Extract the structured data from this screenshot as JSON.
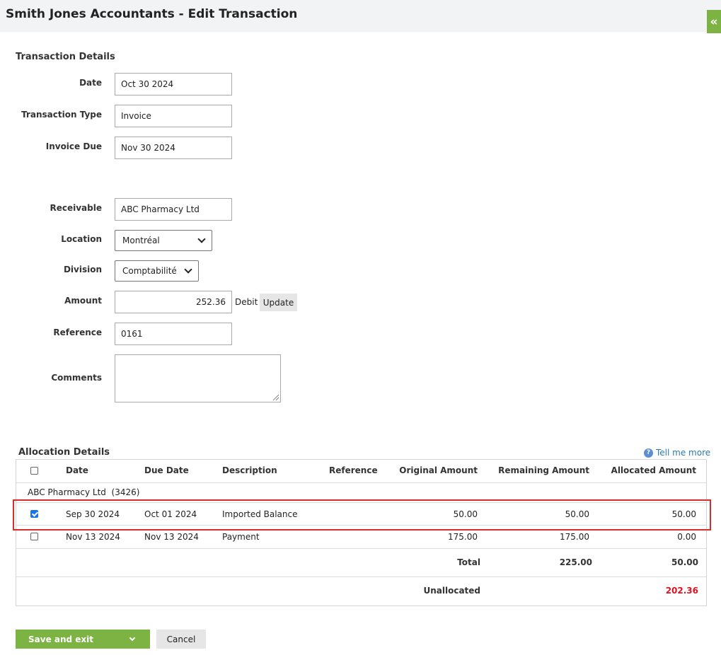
{
  "header": {
    "title": "Smith Jones Accountants - Edit Transaction",
    "collapse_icon": "double-chevron-left-icon",
    "collapse_glyph": "«"
  },
  "transaction": {
    "section_title": "Transaction Details",
    "date_label": "Date",
    "date_value": "Oct 30 2024",
    "type_label": "Transaction Type",
    "type_value": "Invoice",
    "due_label": "Invoice Due",
    "due_value": "Nov 30 2024",
    "receivable_label": "Receivable",
    "receivable_value": "ABC Pharmacy Ltd",
    "location_label": "Location",
    "location_value": "Montréal",
    "division_label": "Division",
    "division_value": "Comptabilité",
    "amount_label": "Amount",
    "amount_value": "252.36",
    "debit_label": "Debit",
    "update_label": "Update",
    "reference_label": "Reference",
    "reference_value": "0161",
    "comments_label": "Comments",
    "comments_value": ""
  },
  "allocation": {
    "section_title": "Allocation Details",
    "help_link": "Tell me more",
    "help_icon": "question-circle-icon",
    "help_glyph": "?",
    "columns": {
      "date": "Date",
      "due_date": "Due Date",
      "description": "Description",
      "reference": "Reference",
      "original": "Original Amount",
      "remaining": "Remaining Amount",
      "allocated": "Allocated Amount"
    },
    "group_label": "ABC Pharmacy Ltd  (3426)",
    "rows": [
      {
        "checked": true,
        "date": "Sep 30 2024",
        "due_date": "Oct 01 2024",
        "description": "Imported Balance",
        "reference": "",
        "original": "50.00",
        "remaining": "50.00",
        "allocated": "50.00"
      },
      {
        "checked": false,
        "date": "Nov 13 2024",
        "due_date": "Nov 13 2024",
        "description": "Payment",
        "reference": "",
        "original": "175.00",
        "remaining": "175.00",
        "allocated": "0.00"
      }
    ],
    "total_label": "Total",
    "total_remaining": "225.00",
    "total_allocated": "50.00",
    "unallocated_label": "Unallocated",
    "unallocated_value": "202.36",
    "unallocated_color": "#e0111f"
  },
  "actions": {
    "save_label": "Save and exit",
    "cancel_label": "Cancel"
  }
}
